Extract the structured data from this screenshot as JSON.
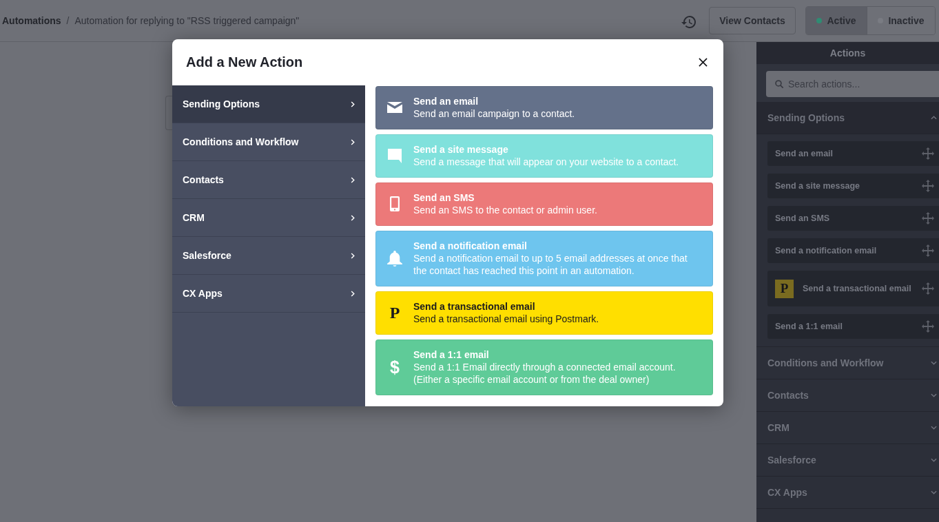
{
  "breadcrumb": {
    "items": [
      {
        "label": "Automations"
      },
      {
        "label": "Automation for replying to \"RSS triggered campaign\""
      }
    ],
    "separator": "/"
  },
  "toolbar": {
    "view_contacts": "View Contacts",
    "status": [
      {
        "label": "Active",
        "selected": true,
        "color": "#2f8c73"
      },
      {
        "label": "Inactive",
        "selected": false,
        "color": "#7a7c83"
      }
    ]
  },
  "modal": {
    "title": "Add a New Action",
    "categories": [
      {
        "label": "Sending Options",
        "selected": true
      },
      {
        "label": "Conditions and Workflow",
        "selected": false
      },
      {
        "label": "Contacts",
        "selected": false
      },
      {
        "label": "CRM",
        "selected": false
      },
      {
        "label": "Salesforce",
        "selected": false
      },
      {
        "label": "CX Apps",
        "selected": false
      }
    ],
    "actions": [
      {
        "kind": "email",
        "title": "Send an email",
        "description": "Send an email campaign to a contact.",
        "color": "#64718a"
      },
      {
        "kind": "message",
        "title": "Send a site message",
        "description": "Send a message that will appear on your website to a contact.",
        "color": "#80e1dc"
      },
      {
        "kind": "sms",
        "title": "Send an SMS",
        "description": "Send an SMS to the contact or admin user.",
        "color": "#ec7979"
      },
      {
        "kind": "notification",
        "title": "Send a notification email",
        "description": "Send a notification email to up to 5 email addresses at once that the contact has reached this point in an automation.",
        "color": "#6ec5ee"
      },
      {
        "kind": "postmark",
        "glyph": "P",
        "title": "Send a transactional email",
        "description": "Send a transactional email using Postmark.",
        "color": "#ffdf00"
      },
      {
        "kind": "dollar",
        "glyph": "$",
        "title": "Send a 1:1 email",
        "description": "Send a 1:1 Email directly through a connected email account. (Either a specific email account or from the deal owner)",
        "color": "#5fcb98"
      }
    ]
  },
  "actions_panel": {
    "title": "Actions",
    "search": {
      "placeholder": "Search actions..."
    },
    "sections": [
      {
        "title": "Sending Options",
        "expanded": true,
        "items": [
          {
            "kind": "plain",
            "label": "Send an email"
          },
          {
            "kind": "plain",
            "label": "Send a site message"
          },
          {
            "kind": "plain",
            "label": "Send an SMS"
          },
          {
            "kind": "plain",
            "label": "Send a notification email"
          },
          {
            "kind": "postmark",
            "logo": "P",
            "label": "Send a transactional email"
          },
          {
            "kind": "plain",
            "label": "Send a 1:1 email"
          }
        ]
      },
      {
        "title": "Conditions and Workflow",
        "expanded": false
      },
      {
        "title": "Contacts",
        "expanded": false
      },
      {
        "title": "CRM",
        "expanded": false
      },
      {
        "title": "Salesforce",
        "expanded": false
      },
      {
        "title": "CX Apps",
        "expanded": false
      }
    ]
  }
}
